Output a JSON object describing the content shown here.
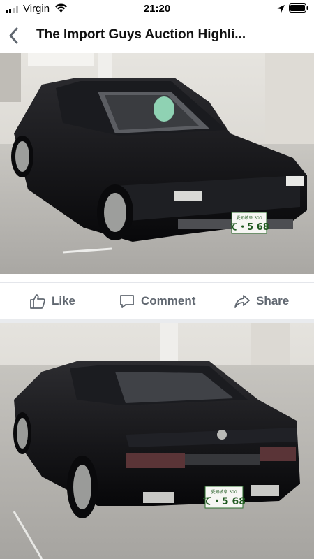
{
  "status": {
    "carrier": "Virgin",
    "time": "21:20"
  },
  "nav": {
    "title": "The Import Guys Auction Highli..."
  },
  "actions": {
    "like": "Like",
    "comment": "Comment",
    "share": "Share"
  },
  "photo1": {
    "plate_top": "愛知岐阜 300",
    "plate_bottom": "て・5 68",
    "description": "Black Maserati Shamal, front three-quarter view in auction hall"
  },
  "photo2": {
    "plate_top": "愛知岐阜 300",
    "plate_bottom": "て・5 68",
    "description": "Black Maserati Shamal, rear three-quarter view in auction hall"
  },
  "icons": [
    "signal-icon",
    "wifi-icon",
    "location-icon",
    "battery-icon",
    "back-chevron-icon",
    "like-thumb-icon",
    "comment-bubble-icon",
    "share-arrow-icon"
  ]
}
